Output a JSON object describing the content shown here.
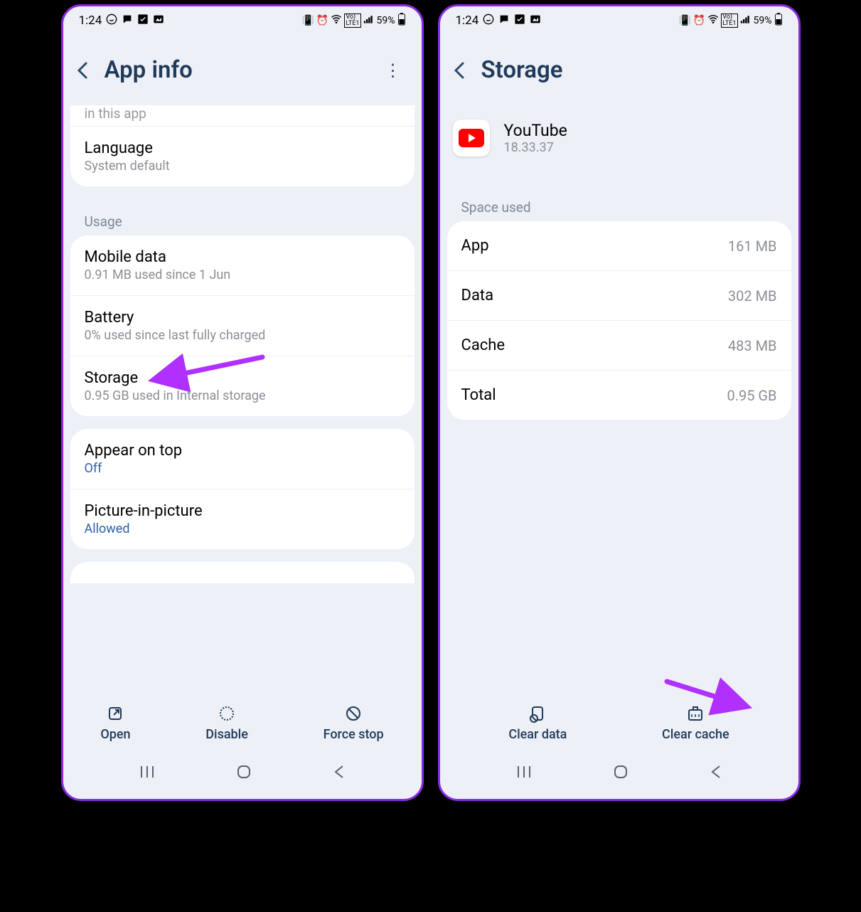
{
  "status": {
    "time": "1:24",
    "battery": "59%"
  },
  "left": {
    "title": "App info",
    "cutText": "in this app",
    "language": {
      "title": "Language",
      "sub": "System default"
    },
    "usageLabel": "Usage",
    "mobileData": {
      "title": "Mobile data",
      "sub": "0.91 MB used since 1 Jun"
    },
    "battery": {
      "title": "Battery",
      "sub": "0% used since last fully charged"
    },
    "storage": {
      "title": "Storage",
      "sub": "0.95 GB used in Internal storage"
    },
    "appearOnTop": {
      "title": "Appear on top",
      "value": "Off"
    },
    "pip": {
      "title": "Picture-in-picture",
      "value": "Allowed"
    },
    "actions": {
      "open": "Open",
      "disable": "Disable",
      "forceStop": "Force stop"
    }
  },
  "right": {
    "title": "Storage",
    "app": {
      "name": "YouTube",
      "version": "18.33.37"
    },
    "spaceLabel": "Space used",
    "rows": {
      "app": {
        "label": "App",
        "value": "161 MB"
      },
      "data": {
        "label": "Data",
        "value": "302 MB"
      },
      "cache": {
        "label": "Cache",
        "value": "483 MB"
      },
      "total": {
        "label": "Total",
        "value": "0.95 GB"
      }
    },
    "actions": {
      "clearData": "Clear data",
      "clearCache": "Clear cache"
    }
  },
  "nav": {
    "recents": "|||",
    "home": "◯",
    "back": "⟨"
  }
}
